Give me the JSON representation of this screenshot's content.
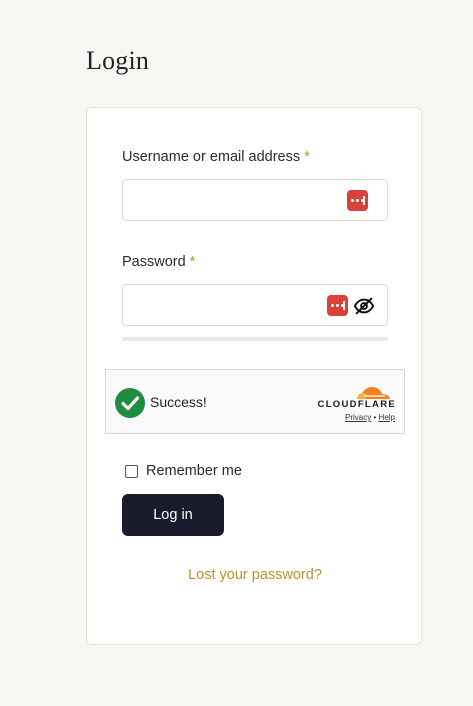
{
  "page": {
    "title": "Login"
  },
  "form": {
    "username_label": "Username or email address",
    "password_label": "Password",
    "required_marker": "*",
    "username_value": "",
    "password_value": ""
  },
  "captcha": {
    "status_text": "Success!",
    "provider": "CLOUDFLARE",
    "privacy_link": "Privacy",
    "separator": "•",
    "help_link": "Help"
  },
  "remember": {
    "label": "Remember me",
    "checked": false
  },
  "actions": {
    "login_label": "Log in",
    "lost_password_label": "Lost your password?"
  },
  "icons": {
    "password_manager": "password-manager-icon",
    "toggle_visibility": "eye-slash-icon",
    "success": "check-circle-icon",
    "provider_logo": "cloudflare-cloud-icon"
  },
  "colors": {
    "accent": "#b8912e",
    "button_bg": "#1a1c2d",
    "password_manager": "#d8423a",
    "success_green": "#1e8e3e",
    "cloudflare_orange": "#f38020"
  }
}
